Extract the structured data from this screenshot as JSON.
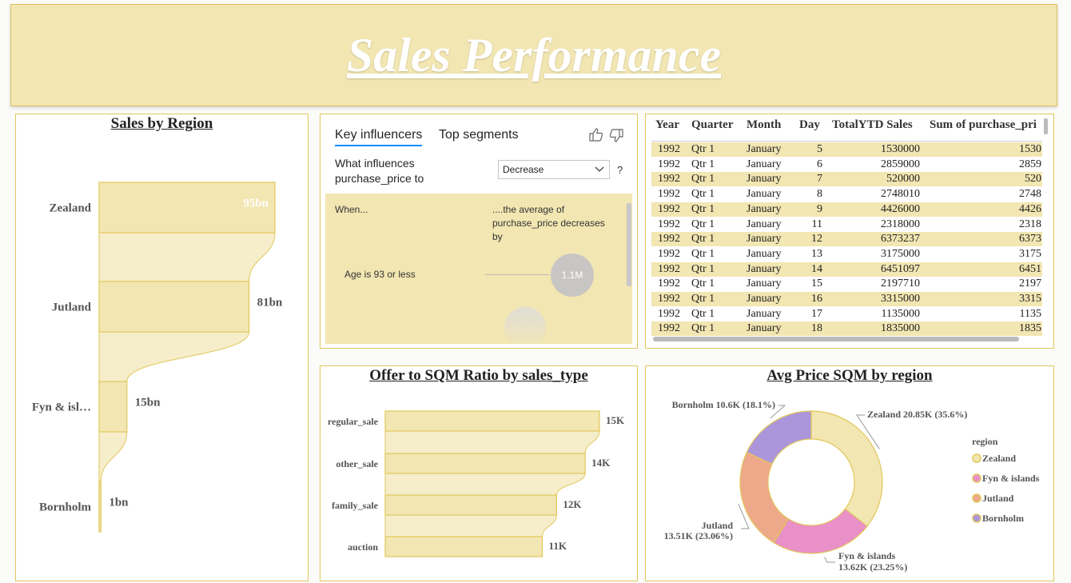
{
  "banner": {
    "title": "Sales Performance"
  },
  "sales_by_region": {
    "title": "Sales by Region",
    "chart_data": {
      "type": "bar",
      "categories": [
        "Zealand",
        "Jutland",
        "Fyn & isl…",
        "Bornholm"
      ],
      "values": [
        95,
        81,
        15,
        1
      ],
      "data_labels": [
        "95bn",
        "81bn",
        "15bn",
        "1bn"
      ],
      "fill_color": "#f2e6b2",
      "ribbon_color": "#f6eecb",
      "border_color": "#e2c75a"
    }
  },
  "key_influencers": {
    "tab_active": "Key influencers",
    "tab_inactive": "Top segments",
    "question_line1": "What influences",
    "question_line2": "purchase_price to",
    "dropdown_value": "Decrease",
    "help": "?",
    "when_label": "When...",
    "result_line1": "....the average of",
    "result_line2": "purchase_price decreases",
    "result_line3": "by",
    "factor_label": "Age is 93 or less",
    "factor_value": "1.1M"
  },
  "table": {
    "headers": [
      "Year",
      "Quarter",
      "Month",
      "Day",
      "TotalYTD Sales",
      "Sum of purchase_pri"
    ],
    "rows": [
      [
        "1992",
        "Qtr 1",
        "January",
        "5",
        "1530000",
        "1530"
      ],
      [
        "1992",
        "Qtr 1",
        "January",
        "6",
        "2859000",
        "2859"
      ],
      [
        "1992",
        "Qtr 1",
        "January",
        "7",
        "520000",
        "520"
      ],
      [
        "1992",
        "Qtr 1",
        "January",
        "8",
        "2748010",
        "2748"
      ],
      [
        "1992",
        "Qtr 1",
        "January",
        "9",
        "4426000",
        "4426"
      ],
      [
        "1992",
        "Qtr 1",
        "January",
        "11",
        "2318000",
        "2318"
      ],
      [
        "1992",
        "Qtr 1",
        "January",
        "12",
        "6373237",
        "6373"
      ],
      [
        "1992",
        "Qtr 1",
        "January",
        "13",
        "3175000",
        "3175"
      ],
      [
        "1992",
        "Qtr 1",
        "January",
        "14",
        "6451097",
        "6451"
      ],
      [
        "1992",
        "Qtr 1",
        "January",
        "15",
        "2197710",
        "2197"
      ],
      [
        "1992",
        "Qtr 1",
        "January",
        "16",
        "3315000",
        "3315"
      ],
      [
        "1992",
        "Qtr 1",
        "January",
        "17",
        "1135000",
        "1135"
      ],
      [
        "1992",
        "Qtr 1",
        "January",
        "18",
        "1835000",
        "1835"
      ]
    ],
    "stripe_color": "#f2e6b2"
  },
  "offer_sqm": {
    "title": "Offer to SQM Ratio by sales_type",
    "chart_data": {
      "type": "bar",
      "categories": [
        "regular_sale",
        "other_sale",
        "family_sale",
        "auction"
      ],
      "values": [
        15,
        14,
        12,
        11
      ],
      "data_labels": [
        "15K",
        "14K",
        "12K",
        "11K"
      ],
      "fill_color": "#f2e6b2"
    }
  },
  "avg_price": {
    "title": "Avg Price SQM by region",
    "chart_data": {
      "type": "pie",
      "categories": [
        "Zealand",
        "Fyn & islands",
        "Jutland",
        "Bornholm"
      ],
      "values": [
        20.85,
        13.62,
        13.51,
        10.6
      ],
      "percentages": [
        35.6,
        23.25,
        23.06,
        18.1
      ],
      "colors": [
        "#f2e6b2",
        "#ea90c8",
        "#eea98a",
        "#ab96dc"
      ],
      "labels": [
        "Zealand 20.85K (35.6%)",
        "Fyn & islands",
        "13.62K (23.25%)",
        "Jutland",
        "13.51K (23.06%)",
        "Bornholm 10.6K (18.1%)"
      ],
      "legend_title": "region",
      "legend": [
        "Zealand",
        "Fyn & islands",
        "Jutland",
        "Bornholm"
      ],
      "legend_position": "right"
    }
  }
}
